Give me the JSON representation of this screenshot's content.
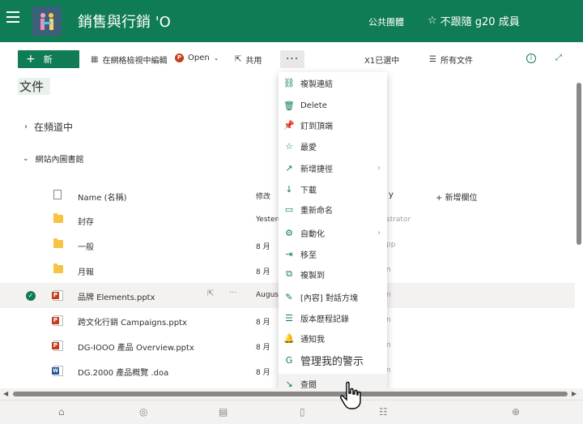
{
  "header": {
    "site_title": "銷售與行銷 'O",
    "group_label": "公共團體",
    "follow_label": "不跟隨 g20 成員",
    "colors": {
      "brand": "#107c55"
    }
  },
  "commandbar": {
    "new_label": "新",
    "edit_grid_label": "在網格檢視中編輯",
    "open_label": "Open",
    "share_label": "共用",
    "selected_label": "X1已選中",
    "view_label": "所有文件"
  },
  "library": {
    "title": "文件",
    "trending_label": "在頻道中",
    "site_lib_label": "網站內圖書館"
  },
  "columns": {
    "name": "Name (名稱)",
    "modified": "修改",
    "by_fragment": "y",
    "add_column": "新增欄位"
  },
  "rows": [
    {
      "name": "封存",
      "date": "Yesterd",
      "right": "strator",
      "type": "folder"
    },
    {
      "name": "一般",
      "date": "8 月",
      "right": "pp",
      "type": "folder"
    },
    {
      "name": "月報",
      "date": "8 月",
      "right": "n",
      "type": "folder"
    },
    {
      "name": "品牌 Elements.pptx",
      "date": "August",
      "right": "n",
      "type": "ppt",
      "selected": true
    },
    {
      "name": "跨文化行銷 Campaigns.pptx",
      "date": "8 月",
      "right": "n",
      "type": "ppt"
    },
    {
      "name": "DG-IOOO 產品 Overview.pptx",
      "date": "8 月",
      "right": "n",
      "type": "ppt"
    },
    {
      "name": "DG.2000 產品概覽 .doa",
      "date": "8 月",
      "right": "n",
      "type": "word"
    }
  ],
  "menu": {
    "items": [
      {
        "label": "複製連結",
        "icon": "link-icon"
      },
      {
        "label": "Delete",
        "icon": "trash-icon"
      },
      {
        "label": "釘到頂端",
        "icon": "pin-icon"
      },
      {
        "label": "最愛",
        "icon": "star-icon"
      },
      {
        "label": "新增捷徑",
        "icon": "shortcut-icon",
        "submenu": true
      },
      {
        "label": "下載",
        "icon": "download-icon"
      },
      {
        "label": "重新命名",
        "icon": "rename-icon"
      },
      {
        "label": "自動化",
        "icon": "automate-icon",
        "submenu": true
      },
      {
        "label": "移至",
        "icon": "move-icon"
      },
      {
        "label": "複製到",
        "icon": "copy-icon"
      },
      {
        "label": "[內容] 對話方塊",
        "icon": "pencil-icon"
      },
      {
        "label": "版本歷程記錄",
        "icon": "history-icon"
      },
      {
        "label": "通知我",
        "icon": "bell-icon"
      },
      {
        "label": "管理我的警示",
        "icon": "alert-icon"
      },
      {
        "label": "查閱",
        "icon": "checkout-icon",
        "hover": true
      }
    ]
  }
}
